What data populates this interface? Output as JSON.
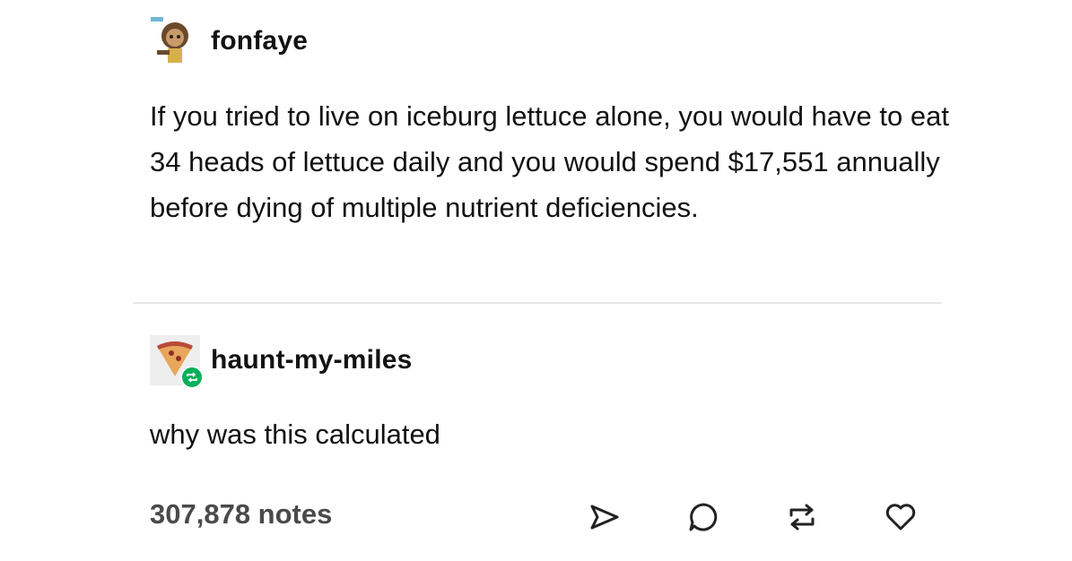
{
  "original_post": {
    "username": "fonfaye",
    "avatar_icon": "cartoon-avatar-icon",
    "text": "If you tried to live on iceburg lettuce alone, you would have to eat 34 heads of lettuce daily and you would spend $17,551 annually before dying of multiple nutrient deficiencies."
  },
  "reblog": {
    "username": "haunt-my-miles",
    "avatar_icon": "pizza-slice-avatar-icon",
    "badge_icon": "reblog-icon",
    "text": "why was this calculated"
  },
  "footer": {
    "notes": "307,878 notes",
    "actions": [
      "share-icon",
      "reply-icon",
      "reblog-icon",
      "like-icon"
    ]
  },
  "colors": {
    "text": "#121212",
    "muted": "#4a4a4a",
    "divider": "#e6e6e6",
    "reblog_badge": "#00b15a"
  }
}
